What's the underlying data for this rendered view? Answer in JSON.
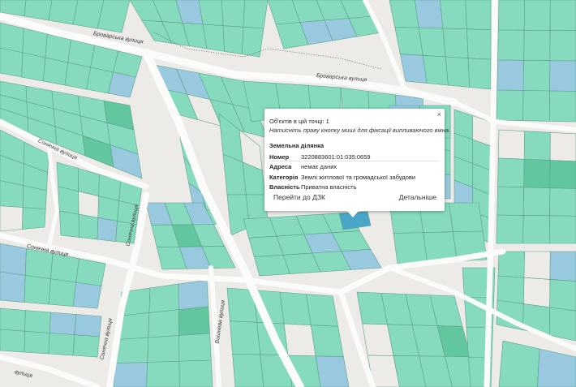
{
  "map": {
    "colors": {
      "background": "#ecebe8",
      "road": "#fbfbfa",
      "parcel_private": "#86dbbf",
      "parcel_private_dark": "#62c79f",
      "parcel_state": "#98c9df",
      "parcel_selected": "#4aa6c9",
      "parcel_outline": "#5c9f8a",
      "border_dots": "#555555"
    },
    "streets": {
      "brovarska_top": "Броварська вулиця",
      "brovarska_right": "Броварська вулиця",
      "sonyachna_1": "Сонячна вулиця",
      "sonyachna_2": "Сонячна вулиця",
      "sonyachna_vert": "Сонячна вулиця",
      "sonyachna_bottom": "Сонячна вулиця",
      "vyshneva": "Вишнева вулиця",
      "bottom_left": "вулиця"
    }
  },
  "popup": {
    "close": "×",
    "count": "Об'єктів в цій точці: 1",
    "hint": "Натисніть праву кнопку миші для фіксації випливаючого вікна.",
    "section": "Земельна ділянка",
    "rows": [
      {
        "key": "Номер",
        "value": "3220883601:01:035:0659"
      },
      {
        "key": "Адреса",
        "value": "немає даних"
      },
      {
        "key": "Категорія",
        "value": "Землі житлової та громадської забудови"
      },
      {
        "key": "Власність",
        "value": "Приватна власність"
      }
    ],
    "link_dzk": "Перейти до ДЗК",
    "link_details": "Детальніше"
  }
}
